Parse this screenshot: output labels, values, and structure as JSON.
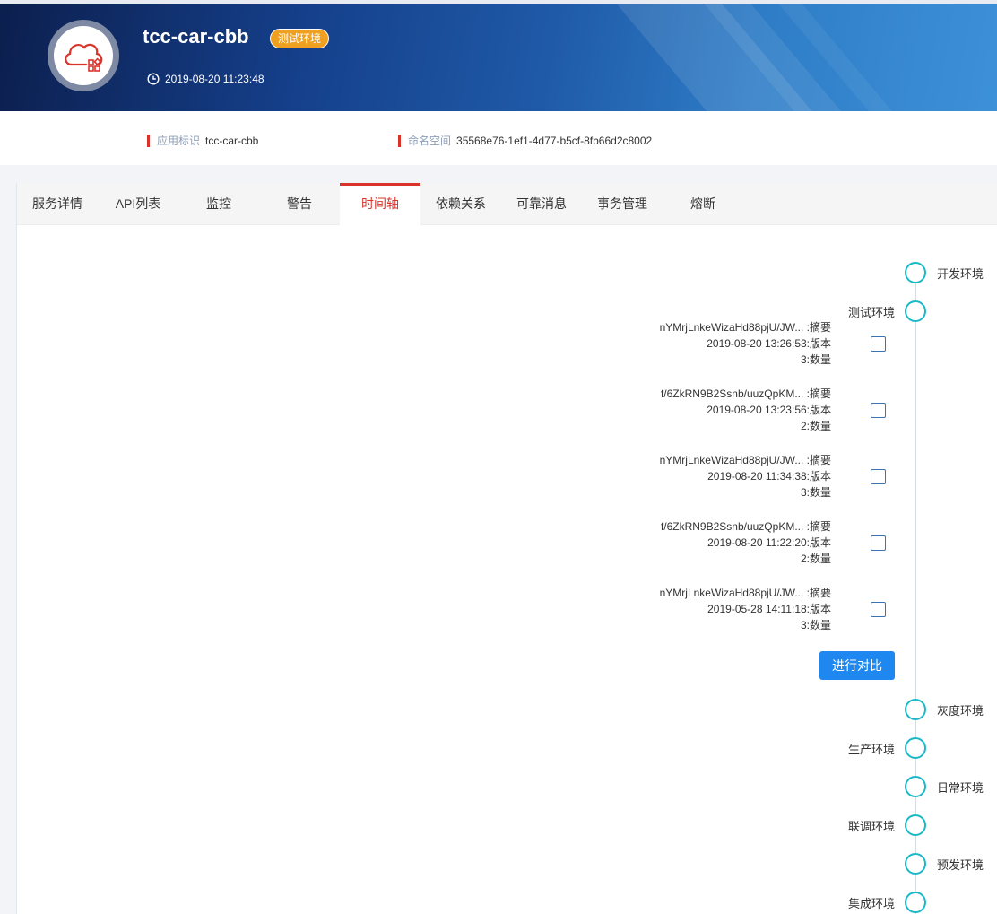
{
  "header": {
    "app_name": "tcc-car-cbb",
    "env_badge": "测试环境",
    "datetime": "2019-08-20 11:23:48",
    "logo_icon": "cloud-app-icon",
    "clock_icon": "clock-icon"
  },
  "info": {
    "app_id_label": "应用标识",
    "app_id_value": "tcc-car-cbb",
    "namespace_label": "命名空间",
    "namespace_value": "35568e76-1ef1-4d77-b5cf-8fb66d2c8002"
  },
  "tabs": [
    {
      "label": "服务详情"
    },
    {
      "label": "API列表"
    },
    {
      "label": "监控"
    },
    {
      "label": "警告"
    },
    {
      "label": "时间轴"
    },
    {
      "label": "依赖关系"
    },
    {
      "label": "可靠消息"
    },
    {
      "label": "事务管理"
    },
    {
      "label": "熔断"
    }
  ],
  "active_tab": "时间轴",
  "timeline": {
    "envs": [
      {
        "label": "开发环境"
      },
      {
        "label": "测试环境"
      },
      {
        "label": "灰度环境"
      },
      {
        "label": "生产环境"
      },
      {
        "label": "日常环境"
      },
      {
        "label": "联调环境"
      },
      {
        "label": "预发环境"
      },
      {
        "label": "集成环境"
      }
    ],
    "entries": [
      {
        "summary": "nYMrjLnkeWizaHd88pjU/JW...  :摘要",
        "version": "2019-08-20 13:26:53:版本",
        "count": "3:数量"
      },
      {
        "summary": "f/6ZkRN9B2Ssnb/uuzQpKM...  :摘要",
        "version": "2019-08-20 13:23:56:版本",
        "count": "2:数量"
      },
      {
        "summary": "nYMrjLnkeWizaHd88pjU/JW...  :摘要",
        "version": "2019-08-20 11:34:38:版本",
        "count": "3:数量"
      },
      {
        "summary": "f/6ZkRN9B2Ssnb/uuzQpKM...  :摘要",
        "version": "2019-08-20 11:22:20:版本",
        "count": "2:数量"
      },
      {
        "summary": "nYMrjLnkeWizaHd88pjU/JW...  :摘要",
        "version": "2019-05-28 14:11:18:版本",
        "count": "3:数量"
      }
    ],
    "compare_button": "进行对比"
  },
  "colors": {
    "accent_red": "#d9342b",
    "badge_orange": "#f0a020",
    "node_cyan": "#1bb8c8",
    "button_blue": "#1e88f0"
  }
}
